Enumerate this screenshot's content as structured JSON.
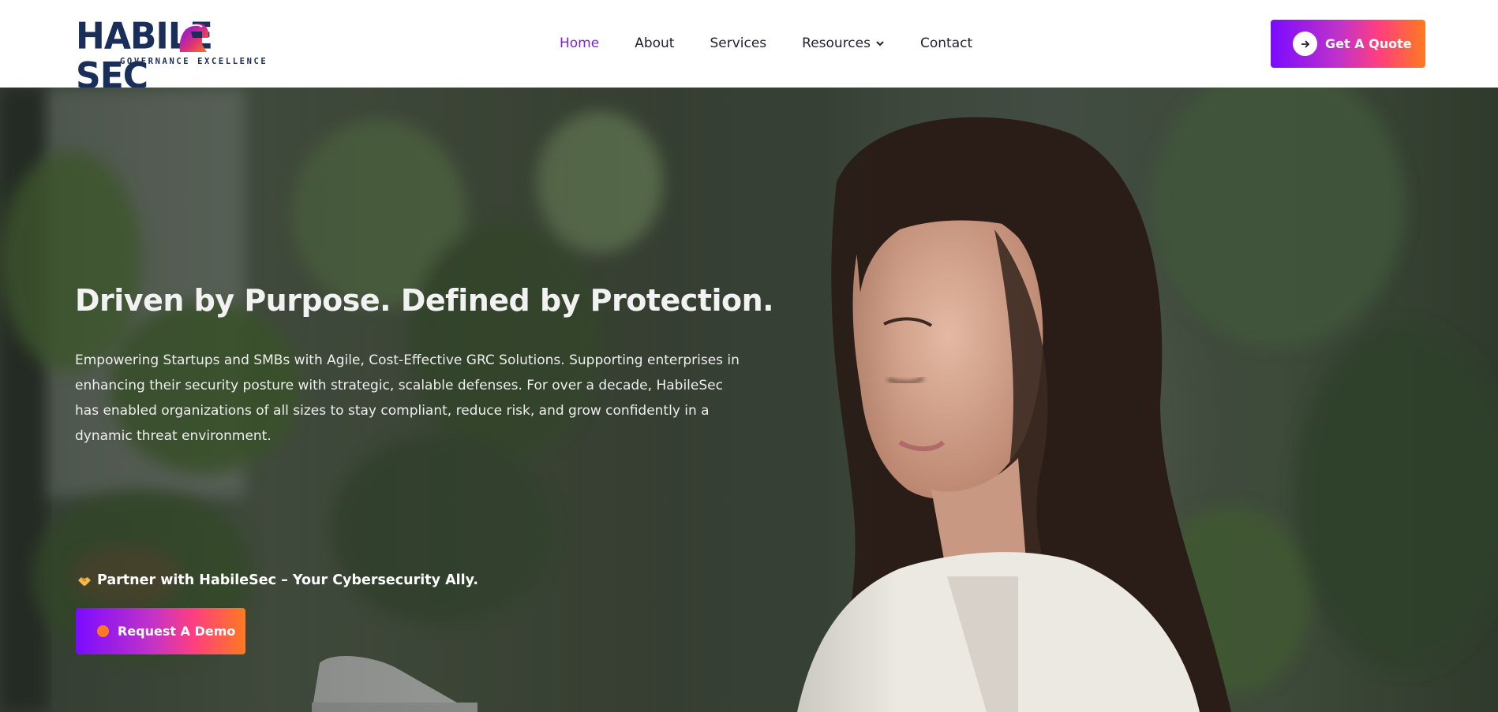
{
  "header": {
    "logo_main": "HABILE SEC",
    "logo_left": "HABILE",
    "logo_right": "SEC",
    "logo_tagline": "GOVERNANCE EXCELLENCE",
    "quote_button": "Get A Quote"
  },
  "nav": {
    "items": [
      {
        "label": "Home",
        "active": true
      },
      {
        "label": "About"
      },
      {
        "label": "Services"
      },
      {
        "label": "Resources",
        "has_dropdown": true
      },
      {
        "label": "Contact"
      }
    ]
  },
  "hero": {
    "title": "Driven by Purpose. Defined by Protection.",
    "description": "Empowering Startups and SMBs with Agile, Cost-Effective GRC Solutions. Supporting enterprises in enhancing their security posture with strategic, scalable defenses. For over a decade, HabileSec has enabled organizations of all sizes to stay compliant, reduce risk, and grow confidently in a dynamic threat environment.",
    "tagline": "Partner with HabileSec – Your Cybersecurity Ally.",
    "tagline_icon": "handshake-icon",
    "demo_button": "Request A Demo"
  },
  "colors": {
    "brand_navy": "#1a2e5a",
    "nav_active": "#7b1fe0",
    "gradient_start": "#7a0bff",
    "gradient_end": "#ff7a1f"
  }
}
